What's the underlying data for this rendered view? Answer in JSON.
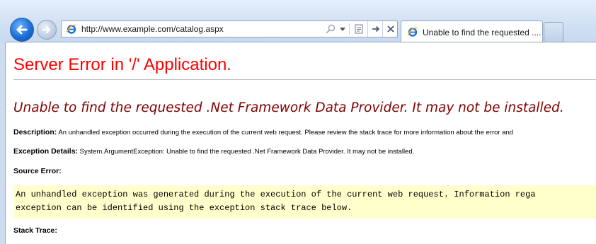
{
  "browser": {
    "address_url": "http://www.example.com/catalog.aspx",
    "tab_title": "Unable to find the requested ...."
  },
  "page": {
    "heading": "Server Error in '/' Application.",
    "error_title": "Unable to find the requested .Net Framework Data Provider.  It may not be installed.",
    "description_label": "Description:",
    "description_text": "An unhandled exception occurred during the execution of the current web request. Please review the stack trace for more information about the error and",
    "exception_label": "Exception Details:",
    "exception_text": "System.ArgumentException: Unable to find the requested .Net Framework Data Provider.  It may not be installed.",
    "source_label": "Source Error:",
    "source_line1": "An unhandled exception was generated during the execution of the current web request. Information rega",
    "source_line2": "exception can be identified using the exception stack trace below.",
    "stack_label": "Stack Trace:"
  },
  "colors": {
    "heading": "#ff0000",
    "error_title": "#800000",
    "code_background": "#ffffcc"
  },
  "icons": [
    "back-arrow-icon",
    "forward-arrow-icon",
    "ie-logo-icon",
    "search-icon",
    "dropdown-icon",
    "compatibility-view-icon",
    "refresh-icon",
    "stop-icon",
    "new-tab-icon"
  ]
}
